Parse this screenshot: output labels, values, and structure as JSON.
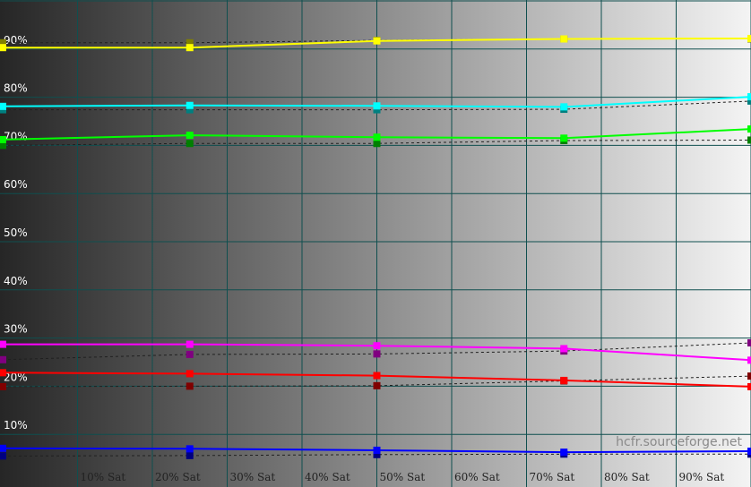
{
  "chart_data": {
    "type": "line",
    "title": "",
    "xlabel": "",
    "ylabel": "",
    "xlim": [
      0,
      100
    ],
    "ylim": [
      0,
      100
    ],
    "x_tick_values": [
      10,
      20,
      30,
      40,
      50,
      60,
      70,
      80,
      90
    ],
    "x_tick_labels": [
      "10% Sat",
      "20% Sat",
      "30% Sat",
      "40% Sat",
      "50% Sat",
      "60% Sat",
      "70% Sat",
      "80% Sat",
      "90% Sat"
    ],
    "y_tick_values": [
      10,
      20,
      30,
      40,
      50,
      60,
      70,
      80,
      90
    ],
    "y_tick_labels": [
      "10%",
      "20%",
      "30%",
      "40%",
      "50%",
      "60%",
      "70%",
      "80%",
      "90%"
    ],
    "grid": true,
    "legend": "none",
    "watermark": "hcfr.sourceforge.net",
    "background": "horizontal gradient, dark gray to white",
    "x": [
      0,
      25,
      50,
      75,
      100
    ],
    "series": [
      {
        "color_name": "yellow",
        "color": "#ffff00",
        "style": "solid",
        "values": [
          90.3,
          90.3,
          91.7,
          92.1,
          92.2
        ]
      },
      {
        "color_name": "yellow-reference",
        "color": "#808000",
        "style": "dashed",
        "values": [
          91.3,
          91.3,
          91.8,
          92.1,
          92.1
        ]
      },
      {
        "color_name": "cyan",
        "color": "#00ffff",
        "style": "solid",
        "values": [
          78.1,
          78.3,
          78.2,
          78.0,
          80.1
        ]
      },
      {
        "color_name": "cyan-reference",
        "color": "#008080",
        "style": "dashed",
        "values": [
          77.4,
          77.4,
          77.4,
          77.5,
          79.2
        ]
      },
      {
        "color_name": "green",
        "color": "#00ff00",
        "style": "solid",
        "values": [
          71.2,
          72.1,
          71.7,
          71.5,
          73.4
        ]
      },
      {
        "color_name": "green-reference",
        "color": "#008000",
        "style": "dashed",
        "values": [
          70.0,
          70.4,
          70.4,
          71.0,
          71.1
        ]
      },
      {
        "color_name": "magenta",
        "color": "#ff00ff",
        "style": "solid",
        "values": [
          28.7,
          28.7,
          28.4,
          27.8,
          25.4
        ]
      },
      {
        "color_name": "magenta-reference",
        "color": "#800080",
        "style": "dashed",
        "values": [
          25.5,
          26.6,
          26.7,
          27.3,
          29.0
        ]
      },
      {
        "color_name": "red",
        "color": "#ff0000",
        "style": "solid",
        "values": [
          22.8,
          22.6,
          22.2,
          21.2,
          19.9
        ]
      },
      {
        "color_name": "red-reference",
        "color": "#800000",
        "style": "dashed",
        "values": [
          19.9,
          20.0,
          20.1,
          21.1,
          22.1
        ]
      },
      {
        "color_name": "blue",
        "color": "#0000ff",
        "style": "solid",
        "values": [
          7.1,
          7.0,
          6.7,
          6.3,
          6.5
        ]
      },
      {
        "color_name": "blue-reference",
        "color": "#000080",
        "style": "dashed",
        "values": [
          5.5,
          5.6,
          5.8,
          5.9,
          5.9
        ]
      }
    ]
  }
}
